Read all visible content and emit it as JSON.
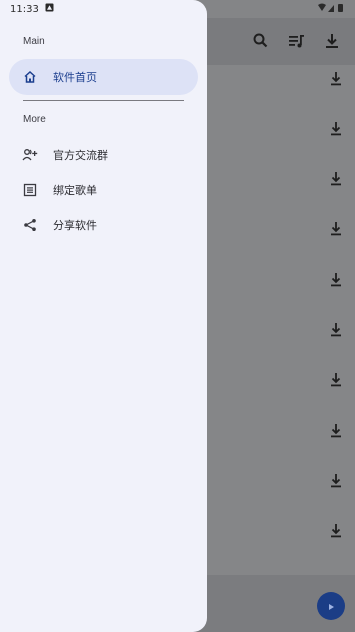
{
  "status": {
    "time": "11:33"
  },
  "drawer": {
    "section_main": "Main",
    "section_more": "More",
    "items": [
      {
        "label": "软件首页",
        "icon": "home-icon",
        "active": true
      },
      {
        "label": "官方交流群",
        "icon": "group-add-icon",
        "active": false
      },
      {
        "label": "绑定歌单",
        "icon": "list-box-icon",
        "active": false
      },
      {
        "label": "分享软件",
        "icon": "share-icon",
        "active": false
      }
    ]
  },
  "colors": {
    "drawer_bg": "#f1f2fa",
    "active_item_bg": "#dde2f6",
    "accent": "#1c3f8f",
    "fab": "#1b3d86"
  }
}
